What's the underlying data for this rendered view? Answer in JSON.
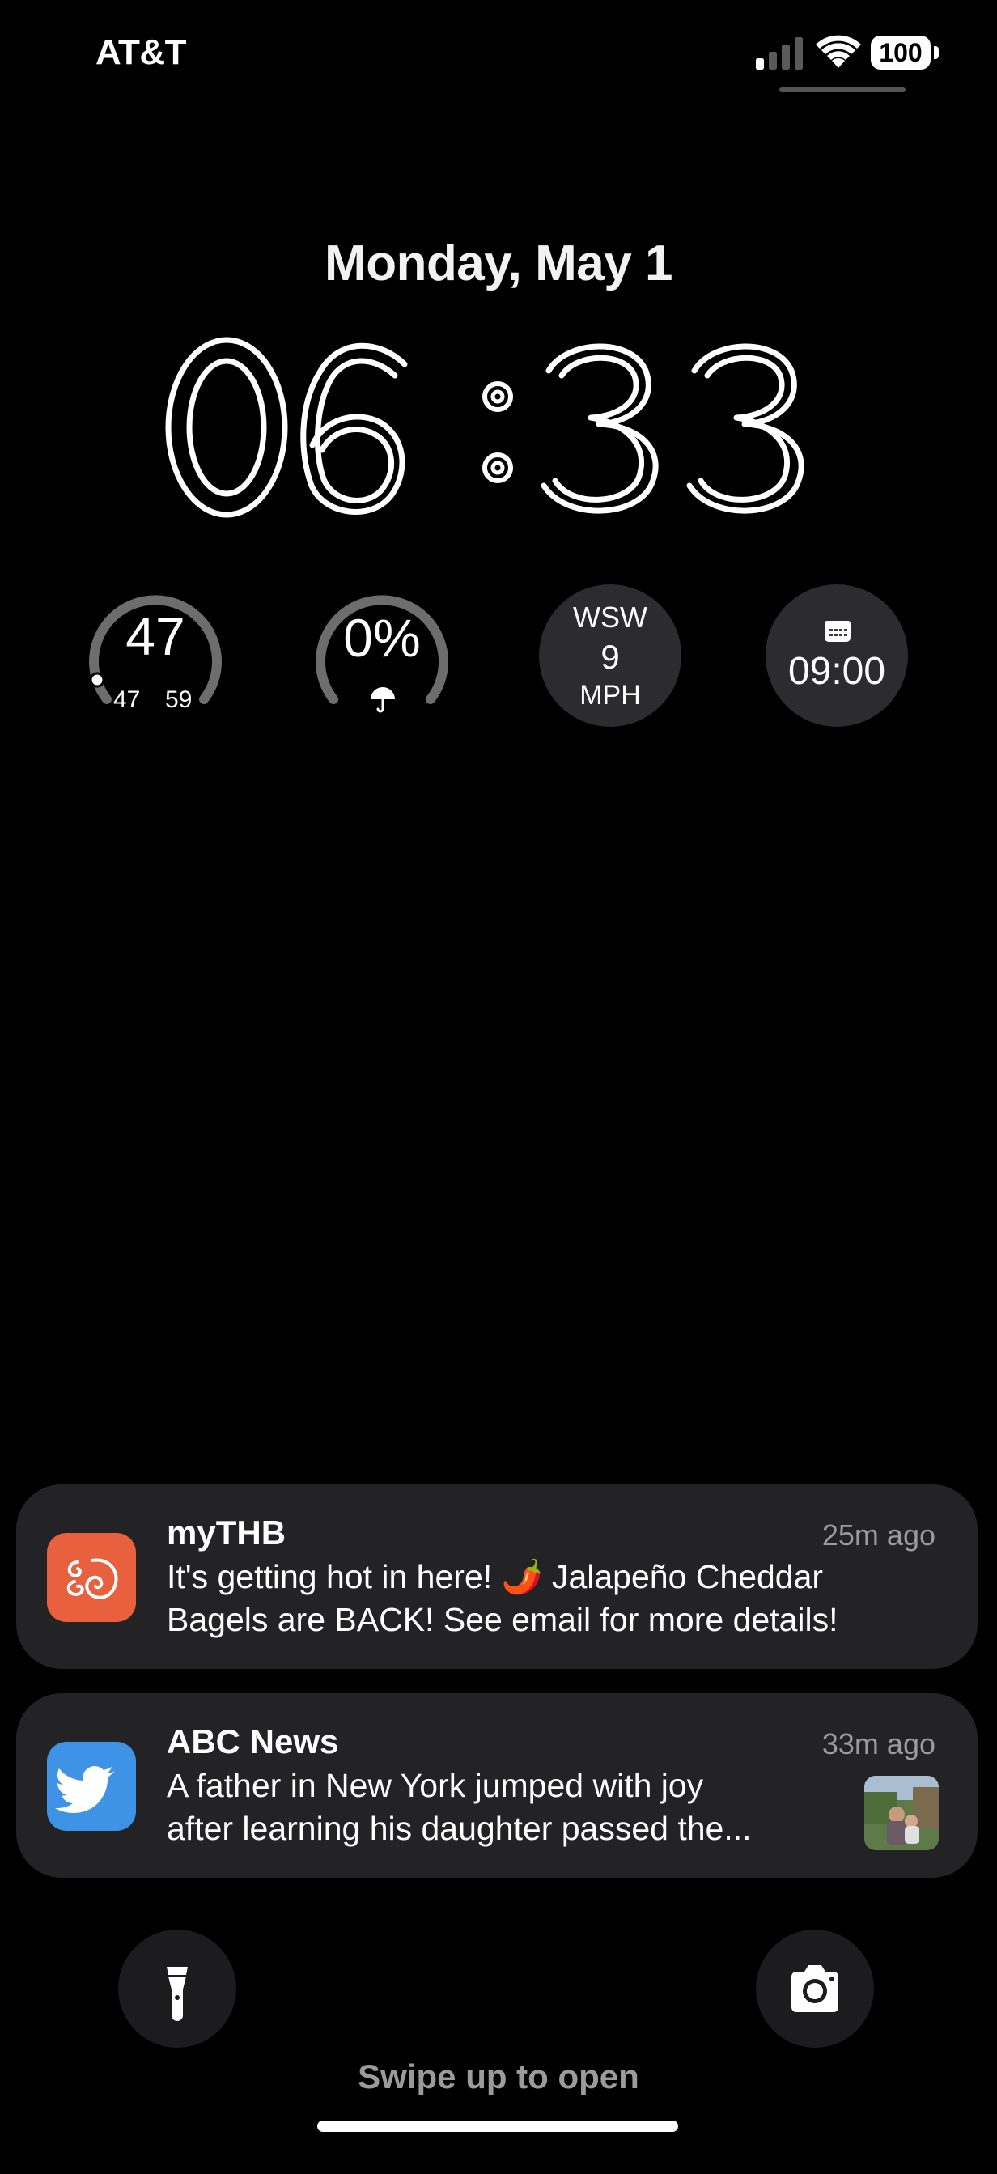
{
  "status_bar": {
    "carrier": "AT&T",
    "battery_level": "100",
    "signal_bars": 1
  },
  "lock_screen": {
    "date": "Monday, May 1",
    "time": "06:33"
  },
  "widgets": {
    "temperature": {
      "current": "47",
      "low": "47",
      "high": "59",
      "gauge_fraction": 0.0
    },
    "precipitation": {
      "value": "0%",
      "icon": "umbrella-icon"
    },
    "wind": {
      "direction": "WSW",
      "speed": "9",
      "unit": "MPH"
    },
    "alarm": {
      "icon": "calendar-icon",
      "time": "09:00"
    }
  },
  "notifications": [
    {
      "app": "myTHB",
      "time": "25m ago",
      "body_line1": "It's getting hot in here! 🌶️ Jalapeño Cheddar",
      "body_line2": "Bagels are BACK! See email for more details!",
      "icon_color": "#e9603f"
    },
    {
      "app": "ABC News",
      "time": "33m ago",
      "body_line1": "A father in New York jumped with joy",
      "body_line2": "after learning his daughter passed the...",
      "icon_color": "#3e93e6"
    }
  ],
  "bottom": {
    "swipe_hint": "Swipe up to open",
    "left_icon": "flashlight-icon",
    "right_icon": "camera-icon"
  }
}
